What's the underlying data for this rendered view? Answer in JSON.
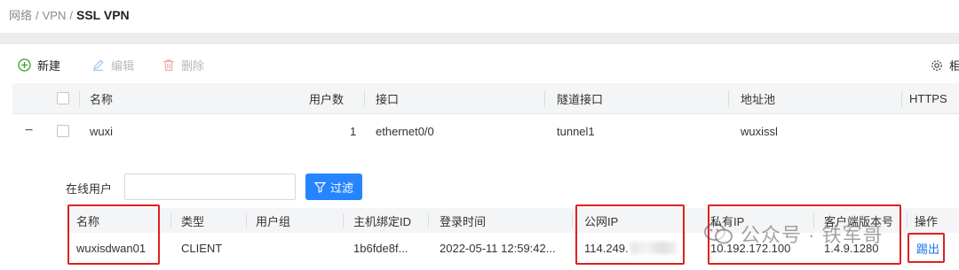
{
  "breadcrumb": {
    "part1": "网络",
    "part2": "VPN",
    "current": "SSL VPN",
    "sep": "/"
  },
  "toolbar": {
    "new_label": "新建",
    "edit_label": "编辑",
    "delete_label": "删除",
    "settings_label": "相"
  },
  "table": {
    "columns": [
      "名称",
      "用户数",
      "接口",
      "隧道接口",
      "地址池",
      "HTTPS"
    ],
    "row": {
      "toggle": "−",
      "name": "wuxi",
      "users": "1",
      "interface": "ethernet0/0",
      "tunnel": "tunnel1",
      "pool": "wuxissl"
    }
  },
  "online": {
    "label": "在线用户",
    "input_value": "",
    "filter_label": "过滤",
    "columns": [
      "名称",
      "类型",
      "用户组",
      "主机绑定ID",
      "登录时间",
      "公网IP",
      "私有IP",
      "客户端版本号",
      "操作"
    ],
    "row": {
      "name": "wuxisdwan01",
      "type": "CLIENT",
      "group": "",
      "host_id": "1b6fde8f...",
      "login_time": "2022-05-11 12:59:42...",
      "public_ip": "114.249.",
      "private_ip": "10.192.172.100",
      "client_version": "1.4.9.1280",
      "action": "踢出"
    }
  },
  "watermark": {
    "text": "公众号 · 铁军哥"
  },
  "colors": {
    "accent": "#2684ff",
    "highlight": "#e02020",
    "link": "#1a73e8",
    "new_icon": "#3c9a2e"
  }
}
